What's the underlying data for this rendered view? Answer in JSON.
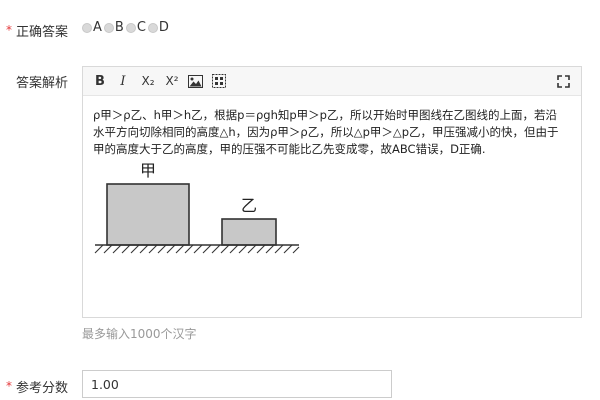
{
  "answer": {
    "required_mark": "*",
    "label": "正确答案",
    "options": [
      "A",
      "B",
      "C",
      "D"
    ]
  },
  "analysis": {
    "label": "答案解析",
    "toolbar": {
      "bold": "B",
      "italic": "I",
      "subscript": "X₂",
      "superscript": "X²"
    },
    "content_line1": "ρ甲＞ρ乙、h甲＞h乙，根据p＝ρgh知p甲＞p乙，所以开始时甲图线在乙图线的上面，若沿",
    "content_line2": "水平方向切除相同的高度△h，因为ρ甲＞ρ乙，所以△p甲＞△p乙，甲压强减小的快，但由于",
    "content_line3": "甲的高度大于乙的高度，甲的压强不可能比乙先变成零，故ABC错误，D正确.",
    "figure_labels": {
      "left_block": "甲",
      "right_block": "乙"
    },
    "hint": "最多输入1000个汉字"
  },
  "score": {
    "required_mark": "*",
    "label": "参考分数",
    "value": "1.00"
  },
  "colors": {
    "required": "#e4393c",
    "border": "#d9d9d9",
    "hint": "#999999"
  }
}
